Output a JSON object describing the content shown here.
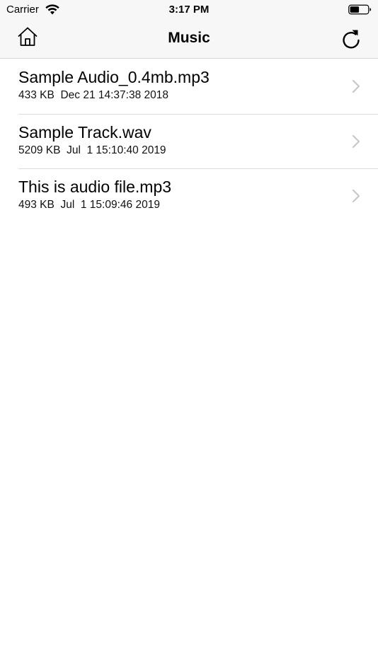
{
  "status_bar": {
    "carrier": "Carrier",
    "time": "3:17 PM",
    "icons": [
      "wifi-icon",
      "battery-icon"
    ]
  },
  "nav": {
    "title": "Music",
    "left_icon": "home-icon",
    "right_icon": "refresh-icon"
  },
  "files": [
    {
      "name": "Sample Audio_0.4mb.mp3",
      "meta": "433 KB  Dec 21 14:37:38 2018"
    },
    {
      "name": "Sample Track.wav",
      "meta": "5209 KB  Jul  1 15:10:40 2019"
    },
    {
      "name": "This is audio file.mp3",
      "meta": "493 KB  Jul  1 15:09:46 2019"
    }
  ],
  "colors": {
    "bar_background": "#f7f7f7",
    "separator": "#dcdcdc",
    "chevron": "#c7c7cc"
  }
}
